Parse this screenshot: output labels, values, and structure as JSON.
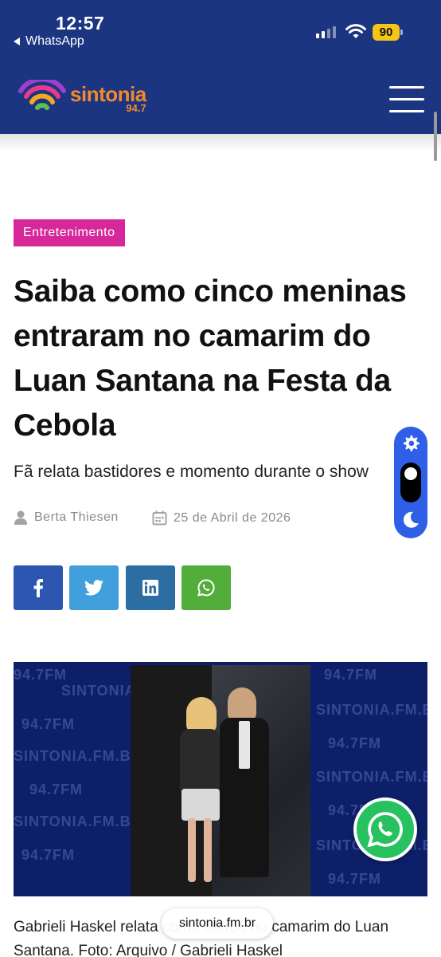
{
  "status_bar": {
    "time": "12:57",
    "back_app": "WhatsApp",
    "battery": "90"
  },
  "header": {
    "logo_name": "sintonia",
    "logo_freq": "94.7",
    "brand_color": "#1c3581",
    "logo_color": "#f28a2d",
    "menu_icon": "hamburger-icon"
  },
  "article": {
    "category": "Entretenimento",
    "category_color": "#d6289a",
    "title": "Saiba como cinco meninas entraram no camarim do Luan Santana na Festa da Cebola",
    "subtitle": "Fã relata bastidores e momento durante o show",
    "author": "Berta Thiesen",
    "date": "25 de Abril de 2026",
    "caption": "Gabrieli Haskel relata como entrou no camarim do Luan Santana. Foto: Arquivo / Gabrieli Haskel"
  },
  "share": {
    "buttons": [
      {
        "name": "facebook",
        "icon": "facebook-icon",
        "color": "#2d56b1"
      },
      {
        "name": "twitter",
        "icon": "twitter-icon",
        "color": "#41a0dc"
      },
      {
        "name": "linkedin",
        "icon": "linkedin-icon",
        "color": "#2a6ea3"
      },
      {
        "name": "whatsapp",
        "icon": "whatsapp-icon",
        "color": "#52ad3b"
      }
    ]
  },
  "photo": {
    "watermark_freq": "94.7FM",
    "watermark_site": "SINTONIA.FM.BR"
  },
  "browser": {
    "url": "sintonia.fm.br"
  }
}
